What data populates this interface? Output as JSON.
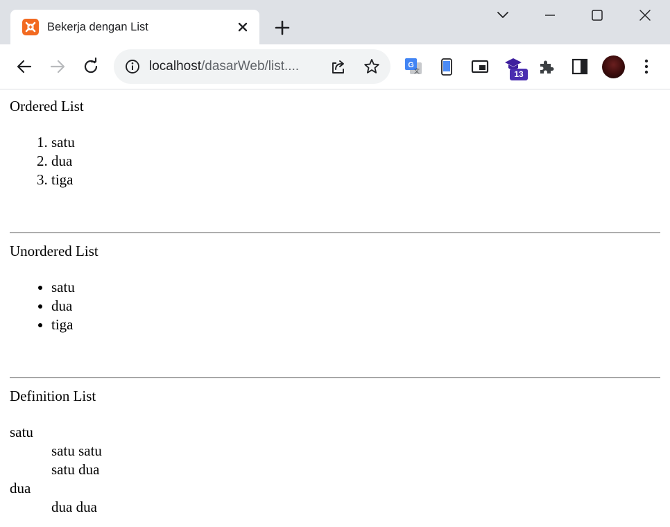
{
  "browser": {
    "tab": {
      "title": "Bekerja dengan List",
      "favicon": "xampp-icon"
    },
    "window_controls": [
      "tab-search-icon",
      "minimize-icon",
      "maximize-icon",
      "close-icon"
    ],
    "toolbar": {
      "url_host": "localhost",
      "url_path": "/dasarWeb/list....",
      "extension_badge": "13",
      "icons": [
        "back-icon",
        "forward-icon",
        "reload-icon",
        "site-info-icon",
        "share-icon",
        "bookmark-star-icon",
        "google-translate-icon",
        "phone-icon",
        "picture-in-picture-icon",
        "graduation-cap-icon",
        "extensions-puzzle-icon",
        "side-panel-icon",
        "avatar",
        "more-menu-icon"
      ]
    }
  },
  "page": {
    "ordered": {
      "heading": "Ordered List",
      "items": [
        "satu",
        "dua",
        "tiga"
      ]
    },
    "unordered": {
      "heading": "Unordered List",
      "items": [
        "satu",
        "dua",
        "tiga"
      ]
    },
    "definition": {
      "heading": "Definition List",
      "terms": [
        {
          "term": "satu",
          "defs": [
            "satu satu",
            "satu dua"
          ]
        },
        {
          "term": "dua",
          "defs": [
            "dua dua"
          ]
        }
      ]
    }
  },
  "colors": {
    "tabstrip": "#dee1e6",
    "omnibox": "#f1f3f4",
    "favicon": "#f26a21",
    "badge": "#4a2db0"
  }
}
